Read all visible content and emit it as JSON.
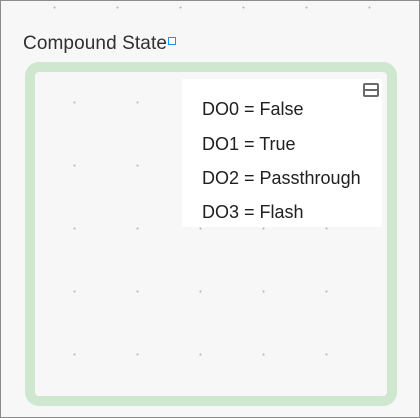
{
  "state": {
    "title": "Compound State",
    "outputs": [
      "DO0 = False",
      "DO1 = True",
      "DO2 = Passthrough",
      "DO3 = Flash"
    ]
  },
  "icons": {
    "anchor": "anchor-square-icon",
    "collapse": "collapse-icon"
  },
  "colors": {
    "state_border": "#cfe6cf",
    "anchor": "#1e90ff",
    "canvas": "#f7f7f7"
  }
}
